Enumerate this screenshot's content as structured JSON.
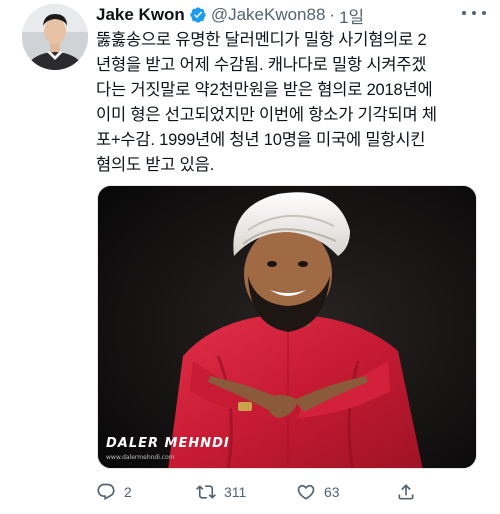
{
  "tweet": {
    "author_name": "Jake Kwon",
    "handle": "@JakeKwon88",
    "separator": "·",
    "time": "1일",
    "text_lines": [
      "뚫훓송으로 유명한 달러멘디가 밀항 사기혐의로 2",
      "년형을 받고 어제 수감됨. 캐나다로 밀항 시켜주겠",
      "다는 거짓말로 약2천만원을 받은 혐의로 2018년에",
      "이미 형은 선고되었지만 이번에 항소가 기각되며 체",
      "포+수감. 1999년에 청년 10명을 미국에 밀항시킨",
      "혐의도 받고 있음."
    ],
    "media": {
      "watermark": "DALER MEHNDI",
      "watermark_url": "www.dalermehndi.com"
    },
    "actions": {
      "reply_count": "2",
      "retweet_count": "311",
      "like_count": "63"
    }
  },
  "icons": {
    "verified": "verified-badge-icon",
    "more": "more-options-icon",
    "reply": "reply-icon",
    "retweet": "retweet-icon",
    "like": "heart-icon",
    "share": "share-icon"
  },
  "colors": {
    "accent": "#1d9bf0",
    "secondary_text": "#536471",
    "primary_text": "#0f1419",
    "turban_white": "#f3f1ee",
    "shirt_red": "#d4213b"
  }
}
